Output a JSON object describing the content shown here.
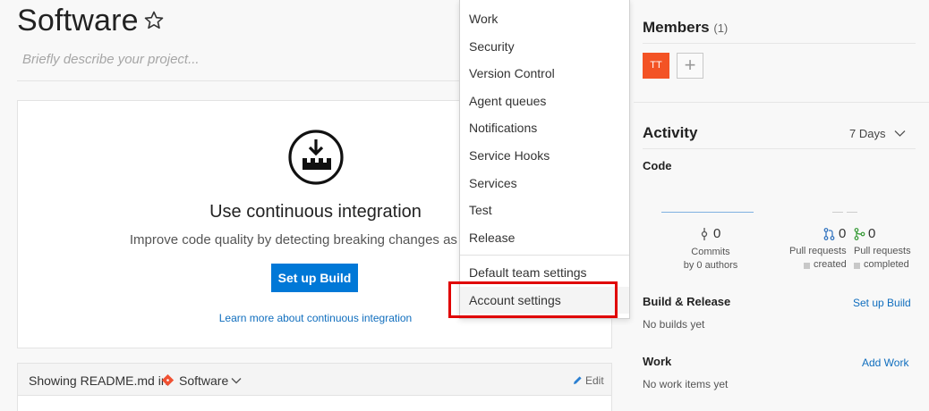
{
  "project": {
    "title": "Software",
    "description_placeholder": "Briefly describe your project..."
  },
  "ci_card": {
    "title": "Use continuous integration",
    "description": "Improve code quality by detecting breaking changes as soon a",
    "button_label": "Set up Build",
    "learn_more": "Learn more about continuous integration"
  },
  "readme": {
    "showing_label": "Showing README.md in",
    "repo_name": "Software",
    "edit_label": "Edit"
  },
  "settings_menu": {
    "items": [
      "Work",
      "Security",
      "Version Control",
      "Agent queues",
      "Notifications",
      "Service Hooks",
      "Services",
      "Test",
      "Release"
    ],
    "team_settings": "Default team settings",
    "account_settings": "Account settings"
  },
  "members": {
    "title": "Members",
    "count": "(1)",
    "avatar_initials": "TT",
    "add_symbol": "+"
  },
  "activity": {
    "title": "Activity",
    "range": "7 Days",
    "code_label": "Code",
    "commits": {
      "count": "0",
      "label_line1": "Commits",
      "label_line2": "by 0 authors"
    },
    "pr_created": {
      "count": "0",
      "label_line1": "Pull requests",
      "label_line2": "created"
    },
    "pr_completed": {
      "count": "0",
      "label_line1": "Pull requests",
      "label_line2": "completed"
    },
    "build_release": {
      "label": "Build & Release",
      "link": "Set up Build",
      "status": "No builds yet"
    },
    "work": {
      "label": "Work",
      "link": "Add Work",
      "status": "No work items yet"
    }
  },
  "colors": {
    "accent": "#0078d7",
    "avatar": "#f35325",
    "highlight": "#e00000",
    "git": "#f05133",
    "pr_completed": "#339933"
  },
  "icons": [
    "star-icon",
    "build-icon",
    "git-icon",
    "chevron-down-icon",
    "pencil-icon",
    "commit-icon",
    "pull-request-icon",
    "merge-icon"
  ]
}
